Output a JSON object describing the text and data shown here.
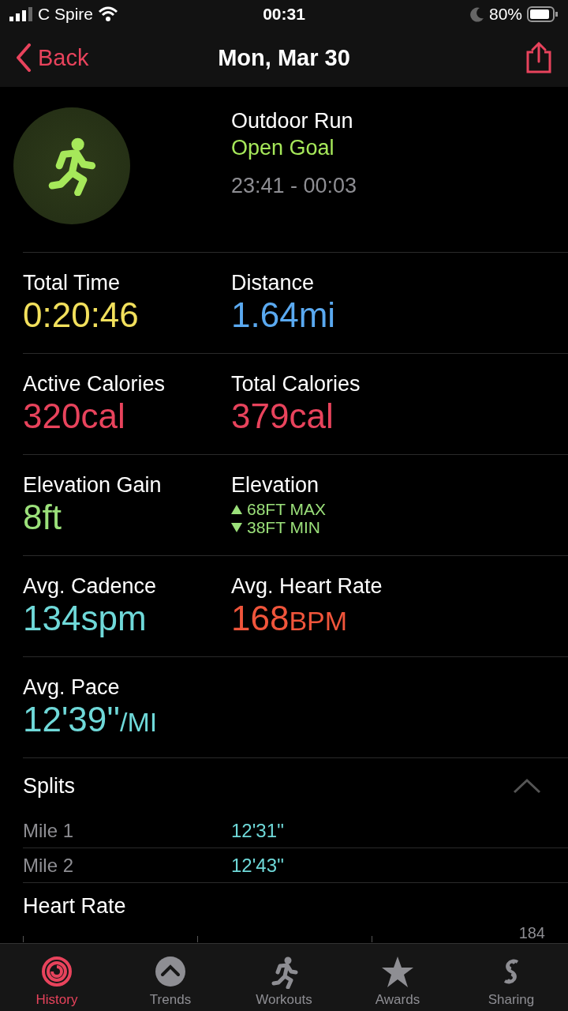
{
  "status_bar": {
    "carrier": "C Spire",
    "time": "00:31",
    "battery": "80%"
  },
  "nav": {
    "back": "Back",
    "title": "Mon, Mar 30"
  },
  "workout": {
    "name": "Outdoor Run",
    "goal": "Open Goal",
    "time_range": "23:41 - 00:03"
  },
  "metrics": [
    {
      "kind": "value",
      "label": "Total Time",
      "value": "0:20:46",
      "color": "#f2e05c"
    },
    {
      "kind": "value",
      "label": "Distance",
      "value": "1.64",
      "unit": "mi",
      "color": "#5aa9f0"
    },
    {
      "kind": "value",
      "label": "Active Calories",
      "value": "320",
      "unit": "cal",
      "color": "#e8435c"
    },
    {
      "kind": "value",
      "label": "Total Calories",
      "value": "379",
      "unit": "cal",
      "color": "#e8435c"
    },
    {
      "kind": "value",
      "label": "Elevation Gain",
      "value": "8",
      "unit": "ft",
      "color": "#9be07a"
    },
    {
      "kind": "range",
      "label": "Elevation",
      "max": "68FT MAX",
      "min": "38FT MIN",
      "color": "#9be07a"
    },
    {
      "kind": "value",
      "label": "Avg. Cadence",
      "value": "134",
      "unit": "spm",
      "color": "#6fd9d9"
    },
    {
      "kind": "value",
      "label": "Avg. Heart Rate",
      "value": "168",
      "unit": "BPM",
      "small_unit": true,
      "color": "#f0553b"
    },
    {
      "kind": "value",
      "label": "Avg. Pace",
      "value": "12'39''",
      "unit": "/MI",
      "small_unit": true,
      "color": "#6fd9d9"
    }
  ],
  "splits": {
    "title": "Splits",
    "expanded": true,
    "rows": [
      {
        "label": "Mile 1",
        "value": "12'31''"
      },
      {
        "label": "Mile 2",
        "value": "12'43''"
      }
    ]
  },
  "heart_rate": {
    "title": "Heart Rate",
    "axis_label": "184"
  },
  "tab_bar": [
    {
      "label": "History",
      "selected": true
    },
    {
      "label": "Trends",
      "selected": false
    },
    {
      "label": "Workouts",
      "selected": false
    },
    {
      "label": "Awards",
      "selected": false
    },
    {
      "label": "Sharing",
      "selected": false
    }
  ]
}
